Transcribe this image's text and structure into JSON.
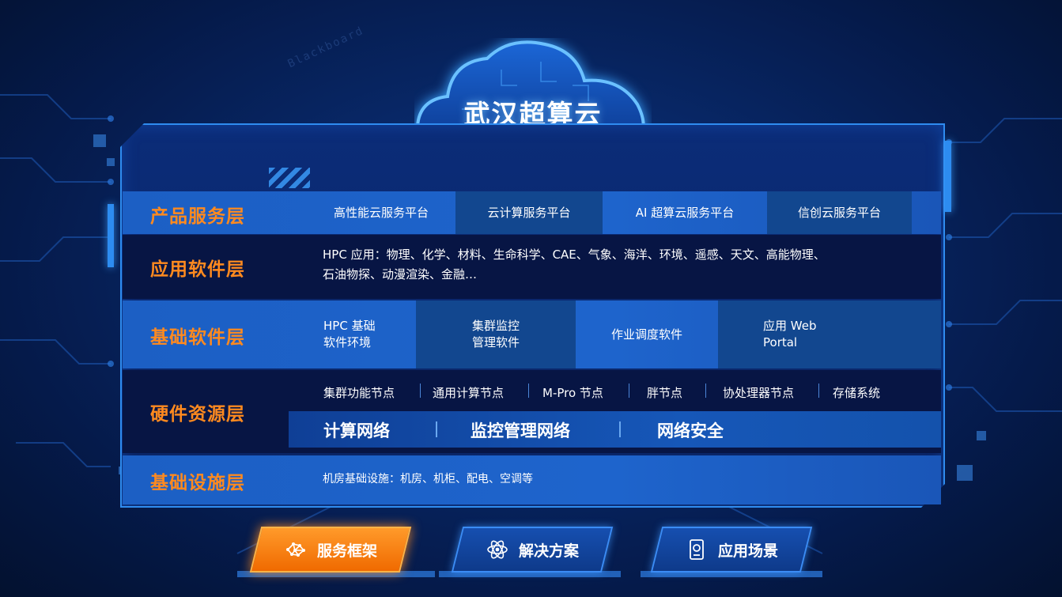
{
  "title": "武汉超算云",
  "background": {
    "watermark": "Blackboard"
  },
  "colors": {
    "label": "#ff8a1f",
    "accent": "#2f8cf0",
    "active_button": "#f47a10"
  },
  "layers": {
    "product": {
      "label": "产品服务层",
      "items": [
        "高性能云服务平台",
        "云计算服务平台",
        "AI 超算云服务平台",
        "信创云服务平台"
      ]
    },
    "application": {
      "label": "应用软件层",
      "line1": "HPC 应用：物理、化学、材料、生命科学、CAE、气象、海洋、环境、遥感、天文、高能物理、",
      "line2": "石油物探、动漫渲染、金融…"
    },
    "base_software": {
      "label": "基础软件层",
      "items": [
        {
          "line1": "HPC 基础",
          "line2": "软件环境"
        },
        {
          "line1": "集群监控",
          "line2": "管理软件"
        },
        {
          "line1": "作业调度软件",
          "line2": ""
        },
        {
          "line1": "应用 Web",
          "line2": "Portal"
        }
      ]
    },
    "hardware": {
      "label": "硬件资源层",
      "nodes": [
        "集群功能节点",
        "通用计算节点",
        "M-Pro 节点",
        "胖节点",
        "协处理器节点",
        "存储系统"
      ],
      "networks": [
        "计算网络",
        "监控管理网络",
        "网络安全"
      ]
    },
    "infrastructure": {
      "label": "基础设施层",
      "text": "机房基础设施：机房、机柜、配电、空调等"
    }
  },
  "buttons": [
    {
      "label": "服务框架",
      "icon": "network-brain-icon",
      "active": true
    },
    {
      "label": "解决方案",
      "icon": "atom-icon",
      "active": false
    },
    {
      "label": "应用场景",
      "icon": "mobile-screen-icon",
      "active": false
    }
  ]
}
